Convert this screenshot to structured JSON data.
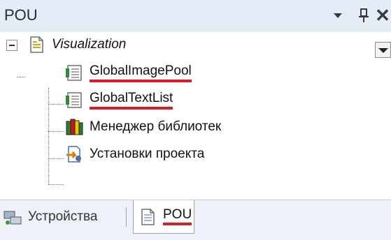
{
  "header": {
    "title": "POU"
  },
  "tree": {
    "root": {
      "label": "Visualization"
    },
    "items": [
      {
        "label": "GlobalImagePool",
        "icon": "list-object-icon"
      },
      {
        "label": "GlobalTextList",
        "icon": "list-object-icon"
      },
      {
        "label": "Менеджер библиотек",
        "icon": "library-books-icon"
      },
      {
        "label": "Установки проекта",
        "icon": "project-settings-icon"
      }
    ]
  },
  "tabs": [
    {
      "label": "Устройства",
      "icon": "devices-icon"
    },
    {
      "label": "POU",
      "icon": "pou-document-icon"
    }
  ],
  "colors": {
    "header_bg": "#e4ecf7",
    "underline": "#d61e2a",
    "tabbar_bg": "#eef2f8"
  }
}
